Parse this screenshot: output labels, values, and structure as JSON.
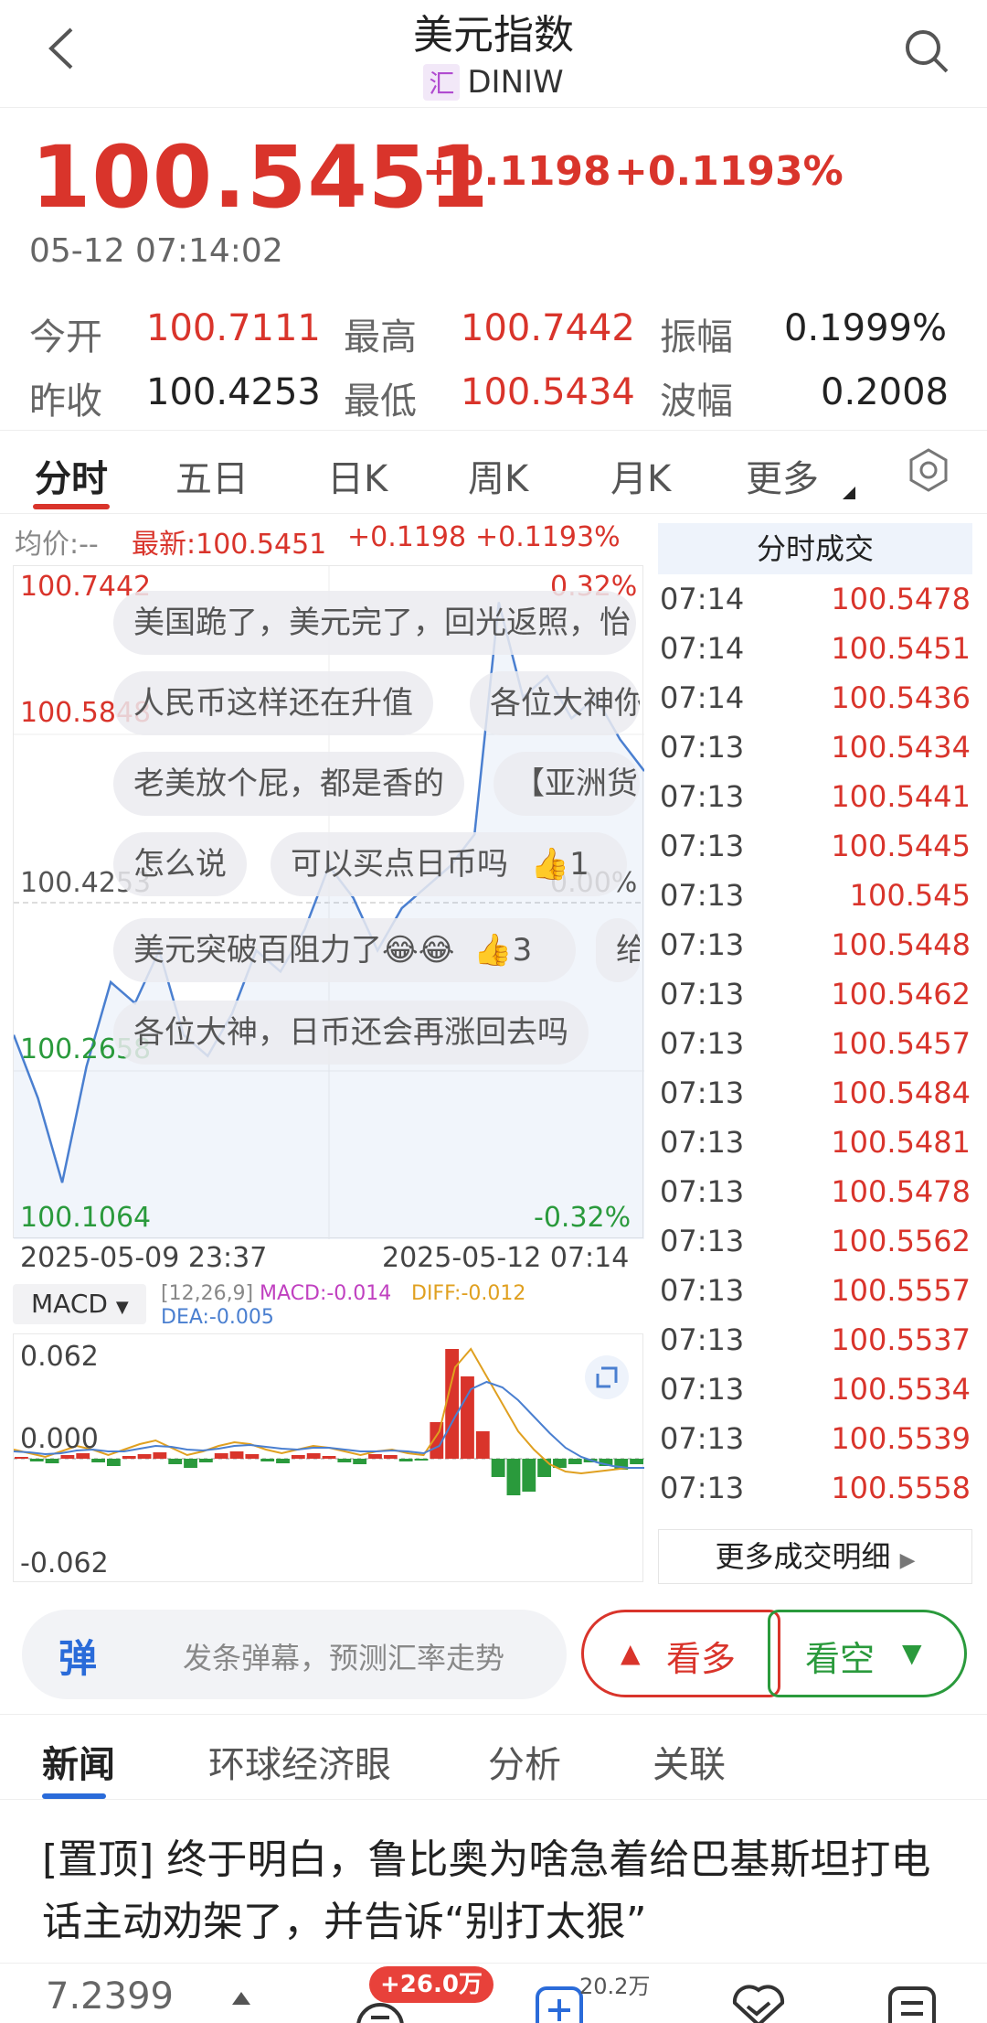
{
  "header": {
    "title": "美元指数",
    "sub_badge": "汇",
    "code": "DINIW"
  },
  "quote": {
    "price": "100.5451",
    "change": "+0.1198",
    "change_pct": "+0.1193%",
    "time": "05-12 07:14:02"
  },
  "stats": {
    "open_label": "今开",
    "open": "100.7111",
    "high_label": "最高",
    "high": "100.7442",
    "amp_label": "振幅",
    "amp": "0.1999%",
    "prev_label": "昨收",
    "prev": "100.4253",
    "low_label": "最低",
    "low": "100.5434",
    "wave_label": "波幅",
    "wave": "0.2008"
  },
  "tabs": [
    "分时",
    "五日",
    "日K",
    "周K",
    "月K",
    "更多"
  ],
  "legend": {
    "avg": "均价:--",
    "latest": "最新:100.5451",
    "chg": "+0.1198",
    "pct": "+0.1193%"
  },
  "chart_axis": {
    "y_top": "100.7442",
    "y_mid_up": "100.5848",
    "y_base": "100.4253",
    "y_mid_dn": "100.2658",
    "y_bottom": "100.1064",
    "pct_top": "0.32%",
    "pct_base": "0.00%",
    "pct_bottom": "-0.32%",
    "start": "2025-05-09 23:37",
    "end": "2025-05-12 07:14"
  },
  "danmaku": [
    {
      "text": "美国跪了，美元完了，回光返照，怡"
    },
    {
      "text": "人民币这样还在升值"
    },
    {
      "text": "各位大神你"
    },
    {
      "text": "老美放个屁，都是香的"
    },
    {
      "text": "【亚洲货"
    },
    {
      "text": "怎么说"
    },
    {
      "text": "可以买点日币吗"
    },
    {
      "text": "美元突破百阻力了😂😂"
    },
    {
      "text": "给"
    },
    {
      "text": "各位大神，日币还会再涨回去吗"
    }
  ],
  "danmaku_likes": {
    "like1": "1",
    "like2": "3"
  },
  "trades": {
    "title": "分时成交",
    "rows": [
      {
        "t": "07:14",
        "p": "100.5478"
      },
      {
        "t": "07:14",
        "p": "100.5451"
      },
      {
        "t": "07:14",
        "p": "100.5436"
      },
      {
        "t": "07:13",
        "p": "100.5434"
      },
      {
        "t": "07:13",
        "p": "100.5441"
      },
      {
        "t": "07:13",
        "p": "100.5445"
      },
      {
        "t": "07:13",
        "p": "100.545"
      },
      {
        "t": "07:13",
        "p": "100.5448"
      },
      {
        "t": "07:13",
        "p": "100.5462"
      },
      {
        "t": "07:13",
        "p": "100.5457"
      },
      {
        "t": "07:13",
        "p": "100.5484"
      },
      {
        "t": "07:13",
        "p": "100.5481"
      },
      {
        "t": "07:13",
        "p": "100.5478"
      },
      {
        "t": "07:13",
        "p": "100.5562"
      },
      {
        "t": "07:13",
        "p": "100.5557"
      },
      {
        "t": "07:13",
        "p": "100.5537"
      },
      {
        "t": "07:13",
        "p": "100.5534"
      },
      {
        "t": "07:13",
        "p": "100.5539"
      },
      {
        "t": "07:13",
        "p": "100.5558"
      }
    ],
    "more": "更多成交明细"
  },
  "macd": {
    "selector": "MACD",
    "params": "[12,26,9]",
    "macd": "MACD:-0.014",
    "diff": "DIFF:-0.012",
    "dea": "DEA:-0.005",
    "y_top": "0.062",
    "y_zero": "0.000",
    "y_bottom": "-0.062"
  },
  "danmaku_input": {
    "icon": "弹",
    "placeholder": "发条弹幕，预测汇率走势"
  },
  "vote": {
    "bull": "看多",
    "bear": "看空"
  },
  "news_tabs": [
    "新闻",
    "环球经济眼",
    "分析",
    "关联"
  ],
  "headline": "[置顶] 终于明白，鲁比奥为啥急着给巴基斯坦打电话主动劝架了，并告诉“别打太狠”",
  "bottom_bar": {
    "value": "7.2399",
    "badge": "+26.0万",
    "count": "20.2万"
  },
  "colors": {
    "up": "#d9342b",
    "down": "#2a9a3c",
    "line": "#4a7fd0",
    "accent": "#2a6bd9"
  },
  "chart_data": {
    "type": "line",
    "x": [
      "2025-05-09 23:37",
      "2025-05-12 07:14"
    ],
    "ylim": [
      100.1064,
      100.7442
    ],
    "series": [
      {
        "values": [
          100.3,
          100.24,
          100.16,
          100.27,
          100.35,
          100.33,
          100.38,
          100.3,
          100.28,
          100.32,
          100.38,
          100.36,
          100.4,
          100.46,
          100.43,
          100.38,
          100.42,
          100.44,
          100.46,
          100.49,
          100.71,
          100.62,
          100.64,
          100.6,
          100.62,
          100.58,
          100.55
        ]
      }
    ]
  }
}
